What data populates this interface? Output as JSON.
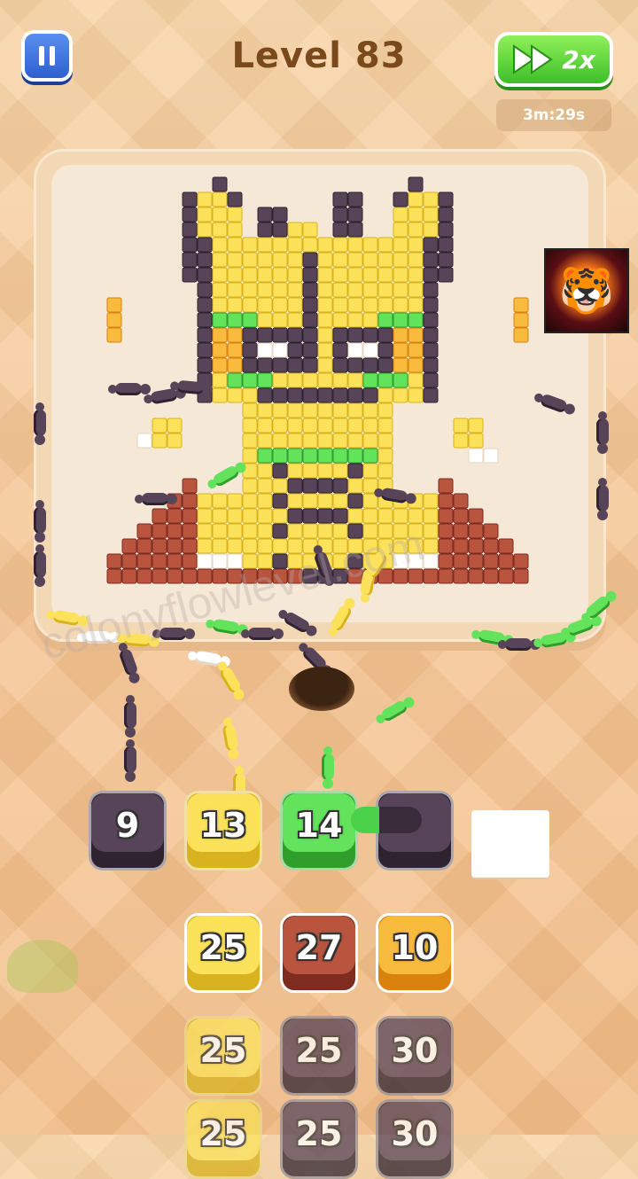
{
  "header": {
    "level_label": "Level 83",
    "speed_label": "2x",
    "timer": "3m:29s"
  },
  "icons": {
    "pause": "pause-icon",
    "speed": "fast-forward-icon",
    "tiger": "tiger-badge-icon"
  },
  "colors": {
    "dark": "#463447",
    "yellow": "#f7d63c",
    "green": "#4cd14a",
    "red": "#a8432f",
    "orange": "#f5a623",
    "white": "#ffffff"
  },
  "watermark": "colonyflowlevel.com",
  "queue": [
    {
      "value": "9",
      "color": "dark"
    },
    {
      "value": "13",
      "color": "yellow"
    },
    {
      "value": "14",
      "color": "green"
    },
    {
      "value": "",
      "color": "dark"
    },
    {
      "value": "",
      "color": "white"
    }
  ],
  "stacks": [
    [
      {
        "value": "25",
        "color": "yellow"
      },
      {
        "value": "25",
        "color": "yellow"
      },
      {
        "value": "25",
        "color": "yellow"
      }
    ],
    [
      {
        "value": "27",
        "color": "red"
      },
      {
        "value": "25",
        "color": "dark"
      },
      {
        "value": "25",
        "color": "dark"
      }
    ],
    [
      {
        "value": "10",
        "color": "orange"
      },
      {
        "value": "30",
        "color": "dark"
      },
      {
        "value": "30",
        "color": "dark"
      }
    ]
  ]
}
